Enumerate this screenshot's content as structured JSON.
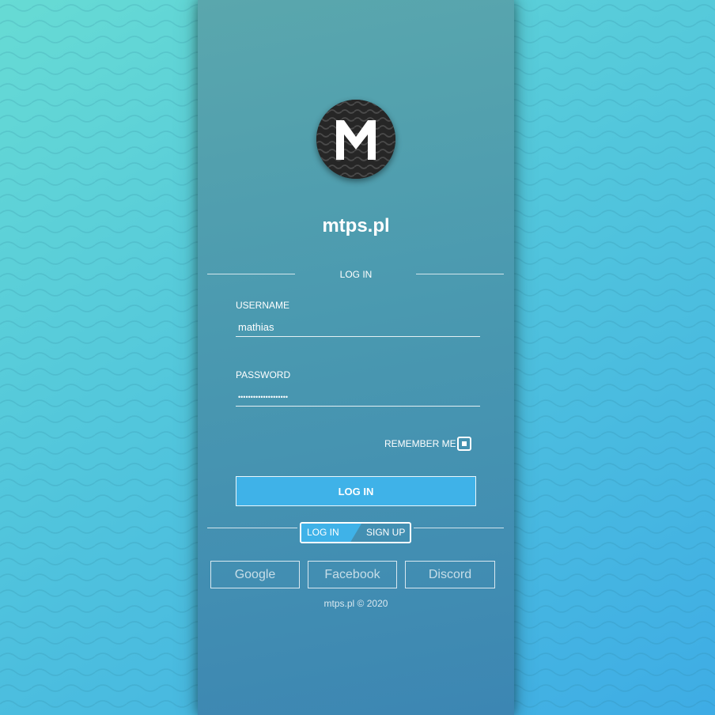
{
  "brand": {
    "title": "mtps.pl",
    "logo_letter": "M"
  },
  "login_section": {
    "heading": "LOG IN"
  },
  "username": {
    "label": "USERNAME",
    "value": "mathias"
  },
  "password": {
    "label": "PASSWORD",
    "value": "••••••••••••••••••••"
  },
  "remember_me": {
    "label": "REMEMBER ME",
    "checked": true
  },
  "login_button": {
    "label": "LOG IN"
  },
  "mode_toggle": {
    "login_label": "LOG IN",
    "signup_label": "SIGN UP",
    "active": "LOG IN"
  },
  "social": {
    "google": "Google",
    "facebook": "Facebook",
    "discord": "Discord"
  },
  "footer": {
    "text": "mtps.pl © 2020"
  },
  "colors": {
    "accent": "#3fb2e8",
    "panel": "#4a99b0",
    "background": "#52c6dc"
  }
}
